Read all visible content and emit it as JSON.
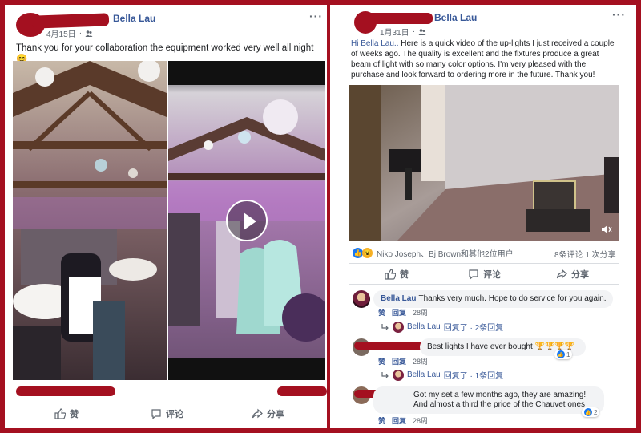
{
  "left_post": {
    "author": "Bella Lau",
    "date": "4月15日",
    "text": "Thank you for your collaboration the equipment worked very well all night😊",
    "actions": {
      "like": "赞",
      "comment": "评论",
      "share": "分享"
    }
  },
  "right_post": {
    "author": "Bella Lau",
    "date": "1月31日",
    "text_mention": "Hi Bella Lau..",
    "text_body": " Here is a quick video of the up-lights I just received a couple of weeks ago. The quality is excellent and the fixtures produce a great beam of light with so many color options. I'm very pleased with the purchase and look forward to ordering more in the future. Thank you!",
    "reactions_text": "Niko Joseph、Bj Brown和其他2位用户",
    "stats": "8条评论  1 次分享",
    "actions": {
      "like": "赞",
      "comment": "评论",
      "share": "分享"
    }
  },
  "comments": [
    {
      "author": "Bella Lau",
      "text": "Thanks very much. Hope to do service for you again.",
      "like": "赞",
      "reply": "回复",
      "time": "28周",
      "reply_summary": {
        "author": "Bella Lau",
        "text": "回复了 · 2条回复"
      }
    },
    {
      "author": "",
      "text": "Best lights I have ever bought 🏆🏆🏆🏆",
      "like": "赞",
      "reply": "回复",
      "time": "28周",
      "likes": "1",
      "reply_summary": {
        "author": "Bella Lau",
        "text": "回复了 · 1条回复"
      }
    },
    {
      "author": "",
      "text": "Got my set a few months ago, they are amazing! And almost a third the price of the Chauvet ones",
      "like": "赞",
      "reply": "回复",
      "time": "28周",
      "likes": "2"
    }
  ],
  "colors": {
    "frame": "#a41020",
    "link": "#385898",
    "like_blue": "#1877f2"
  },
  "icons": [
    "more-icon",
    "globe-icon",
    "like-icon",
    "comment-icon",
    "share-icon",
    "play-icon",
    "volume-icon",
    "wow-reaction-icon",
    "like-reaction-icon"
  ]
}
